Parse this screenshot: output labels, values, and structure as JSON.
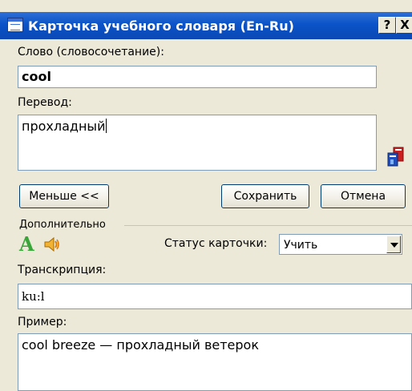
{
  "window": {
    "title": "Карточка учебного словаря (En-Ru)",
    "help_label": "?",
    "close_label": "X"
  },
  "word": {
    "label": "Слово (словосочетание):",
    "value": "cool"
  },
  "translation": {
    "label": "Перевод:",
    "value": "прохладный"
  },
  "buttons": {
    "less": "Меньше <<",
    "save": "Сохранить",
    "cancel": "Отмена"
  },
  "extra": {
    "group_label": "Дополнительно",
    "status_label": "Статус карточки:",
    "status_value": "Учить",
    "font_icon_letter": "A"
  },
  "transcription": {
    "label": "Транскрипция:",
    "value": "ku:l"
  },
  "example": {
    "label": "Пример:",
    "value": "cool breeze — прохладный ветерок"
  },
  "colors": {
    "titlebar": "#0a53c8",
    "window_bg": "#ece9d8",
    "field_border": "#7f9db9",
    "font_icon": "#3aa63a"
  },
  "icons": [
    "dictionary-window-icon",
    "dictionary-books-icon",
    "font-letter-icon",
    "speaker-icon",
    "chevron-down-icon"
  ]
}
